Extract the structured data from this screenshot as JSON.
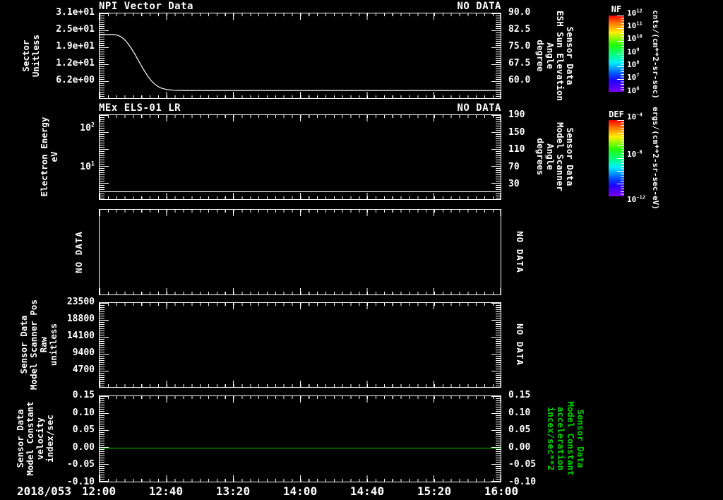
{
  "page": {
    "background": "#000000",
    "foreground": "#ffffff",
    "accent_green": "#00d200"
  },
  "x_axis": {
    "date_label": "2018/053",
    "tick_labels": [
      "12:00",
      "12:40",
      "13:20",
      "14:00",
      "14:40",
      "15:20",
      "16:00"
    ]
  },
  "panels": [
    {
      "title": "NPI Vector Data",
      "status": "NO DATA",
      "left_label": "Sector\nUnitless",
      "left_ticks": [
        {
          "t": "3.1e+01",
          "f": 0.0
        },
        {
          "t": "2.5e+01",
          "f": 0.197
        },
        {
          "t": "1.9e+01",
          "f": 0.393
        },
        {
          "t": "1.2e+01",
          "f": 0.59
        },
        {
          "t": "6.2e+00",
          "f": 0.787
        }
      ],
      "right_ticks": [
        {
          "t": "90.0",
          "f": 0.0
        },
        {
          "t": "82.5",
          "f": 0.197
        },
        {
          "t": "75.0",
          "f": 0.393
        },
        {
          "t": "67.5",
          "f": 0.59
        },
        {
          "t": "60.0",
          "f": 0.787
        }
      ],
      "right_label": "Sensor Data\nESH Sun Elevation\nAngle\ndegree"
    },
    {
      "title": "MEx ELS-01 LR",
      "status": "NO DATA",
      "left_label": "Electron Energy\neV",
      "left_ticks": [
        {
          "t": "10^2",
          "f": 0.165
        },
        {
          "t": "10^1",
          "f": 0.62
        }
      ],
      "right_ticks": [
        {
          "t": "190",
          "f": 0.008
        },
        {
          "t": "150",
          "f": 0.215
        },
        {
          "t": "110",
          "f": 0.413
        },
        {
          "t": "70",
          "f": 0.62
        },
        {
          "t": "30",
          "f": 0.818
        }
      ],
      "right_label": "Sensor Data\nModel Scanner\nAngle\ndegrees"
    },
    {
      "left_no_data": "NO DATA",
      "right_no_data": "NO DATA"
    },
    {
      "left_label": "Sensor Data\nModel Scanner Pos\nRaw\nunitless",
      "left_ticks": [
        {
          "t": "23500",
          "f": 0.0
        },
        {
          "t": "18800",
          "f": 0.198
        },
        {
          "t": "14100",
          "f": 0.397
        },
        {
          "t": "9400",
          "f": 0.595
        },
        {
          "t": "4700",
          "f": 0.793
        }
      ],
      "right_no_data": "NO DATA"
    },
    {
      "left_label": "Sensor Data\nModel Constant\nvelocity\nindex/sec",
      "left_ticks": [
        {
          "t": "0.15",
          "f": 0.0
        },
        {
          "t": "0.10",
          "f": 0.2
        },
        {
          "t": "0.05",
          "f": 0.4
        },
        {
          "t": "0.00",
          "f": 0.6
        },
        {
          "t": "-0.05",
          "f": 0.8
        },
        {
          "t": "-0.10",
          "f": 1.0
        }
      ],
      "right_ticks": [
        {
          "t": "0.15",
          "f": 0.0
        },
        {
          "t": "0.10",
          "f": 0.2
        },
        {
          "t": "0.05",
          "f": 0.4
        },
        {
          "t": "0.00",
          "f": 0.6
        },
        {
          "t": "-0.05",
          "f": 0.8
        },
        {
          "t": "-0.10",
          "f": 1.0
        }
      ],
      "right_label": "Sensor Data\nModel Constant\nacceleration\nincex/sec**2"
    }
  ],
  "colorbars": [
    {
      "name": "NF",
      "units": "cnts/(cm**2-sr-sec)",
      "ticks": [
        "10^12",
        "10^11",
        "10^10",
        "10^9",
        "10^8",
        "10^7",
        "10^6"
      ],
      "tick_fracs": [
        -0.04,
        0.13,
        0.3,
        0.47,
        0.64,
        0.81,
        0.98
      ]
    },
    {
      "name": "DEF",
      "units": "ergs/(cm**2-sr-sec-eV)",
      "ticks": [
        "10^-4",
        "10^-8",
        "10^-12"
      ],
      "tick_fracs": [
        -0.05,
        0.44,
        1.04
      ]
    }
  ],
  "chart_data": [
    {
      "type": "line",
      "panel": "NPI Vector Data",
      "title": "NPI Vector Data",
      "annotation": "NO DATA",
      "ylabel": "Sector Unitless",
      "ylabel_right": "Sensor Data ESH Sun Elevation Angle degree",
      "xlim": [
        "12:00",
        "16:00"
      ],
      "ylim": [
        0,
        31.3
      ],
      "ylim_right": [
        57.5,
        90
      ],
      "yticks": [
        31,
        25,
        19,
        12,
        6.2
      ],
      "yticks_right": [
        90.0,
        82.5,
        75.0,
        67.5,
        60.0
      ],
      "series": [
        {
          "name": "Sector",
          "color": "#ffffff",
          "x_minutes_after_1200": [
            0,
            9,
            11,
            13,
            15,
            17,
            19,
            21,
            23,
            25,
            27,
            29,
            31,
            33,
            35,
            37,
            40,
            44,
            50,
            240
          ],
          "values": [
            23.5,
            23.5,
            23.2,
            22.6,
            21.6,
            20.2,
            18.4,
            16.4,
            14.2,
            12.0,
            9.9,
            8.0,
            6.4,
            5.2,
            4.3,
            3.7,
            3.2,
            2.95,
            2.85,
            2.85
          ]
        }
      ]
    },
    {
      "type": "line",
      "panel": "MEx ELS-01 LR",
      "annotation": "NO DATA",
      "ylabel": "Electron Energy eV",
      "yscale": "log",
      "ylim": [
        1.45,
        230
      ],
      "yticks": [
        100,
        10
      ],
      "ylabel_right": "Sensor Data Model Scanner Angle degrees",
      "yticks_right": [
        190,
        150,
        110,
        70,
        30
      ],
      "series": [
        {
          "name": "lower energy bound",
          "color": "#ffffff",
          "constant_value_eV": 2.5
        }
      ]
    },
    {
      "type": "none",
      "panel": "panel-3",
      "annotation": "NO DATA"
    },
    {
      "type": "none",
      "panel": "panel-4",
      "annotation": "NO DATA",
      "ylabel": "Sensor Data Model Scanner Pos Raw unitless",
      "ylim": [
        0,
        23500
      ],
      "yticks": [
        23500,
        18800,
        14100,
        9400,
        4700
      ]
    },
    {
      "type": "line",
      "panel": "panel-5",
      "ylabel": "Sensor Data Model Constant velocity index/sec",
      "ylabel_right": "Sensor Data Model Constant acceleration incex/sec**2",
      "ylim": [
        -0.1,
        0.15
      ],
      "yticks": [
        0.15,
        0.1,
        0.05,
        0.0,
        -0.05,
        -0.1
      ],
      "x_axis_date": "2018/053",
      "xticks": [
        "12:00",
        "12:40",
        "13:20",
        "14:00",
        "14:40",
        "15:20",
        "16:00"
      ],
      "series": [
        {
          "name": "velocity",
          "color": "#00d200",
          "constant_value": 0.0
        }
      ]
    }
  ]
}
